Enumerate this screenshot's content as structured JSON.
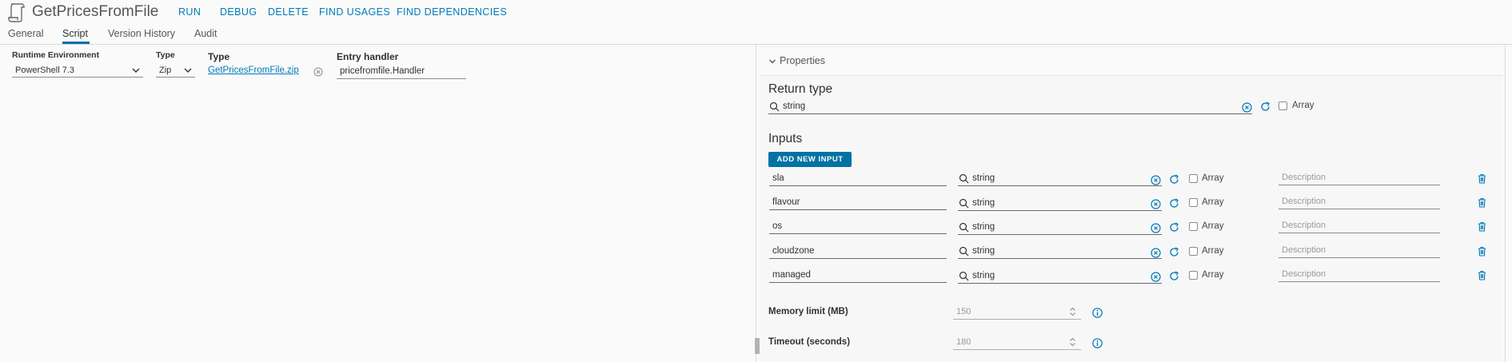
{
  "header": {
    "title": "GetPricesFromFile",
    "actions": [
      "RUN",
      "DEBUG",
      "DELETE",
      "FIND USAGES",
      "FIND DEPENDENCIES"
    ],
    "tabs": [
      "General",
      "Script",
      "Version History",
      "Audit"
    ],
    "active_tab": "Script"
  },
  "script": {
    "runtime_label": "Runtime Environment",
    "runtime_value": "PowerShell 7.3",
    "type_label": "Type",
    "type_value": "Zip",
    "file_type_label": "Type",
    "file_name": "GetPricesFromFile.zip",
    "entry_label": "Entry handler",
    "entry_value": "pricefromfile.Handler"
  },
  "properties": {
    "title": "Properties",
    "return_type_title": "Return type",
    "return_type_value": "string",
    "array_label": "Array",
    "inputs_title": "Inputs",
    "add_input_label": "ADD NEW INPUT",
    "inputs": [
      {
        "name": "sla",
        "type": "string",
        "array": "Array",
        "description_placeholder": "Description"
      },
      {
        "name": "flavour",
        "type": "string",
        "array": "Array",
        "description_placeholder": "Description"
      },
      {
        "name": "os",
        "type": "string",
        "array": "Array",
        "description_placeholder": "Description"
      },
      {
        "name": "cloudzone",
        "type": "string",
        "array": "Array",
        "description_placeholder": "Description"
      },
      {
        "name": "managed",
        "type": "string",
        "array": "Array",
        "description_placeholder": "Description"
      }
    ],
    "memory_label": "Memory limit (MB)",
    "memory_value": "150",
    "timeout_label": "Timeout (seconds)",
    "timeout_value": "180"
  },
  "colors": {
    "accent": "#0072a3",
    "link": "#0079b8"
  },
  "icons": [
    "script-logo-icon",
    "chevron-down-icon",
    "clear-circle-icon",
    "search-icon",
    "refresh-icon",
    "trash-icon",
    "info-icon"
  ]
}
